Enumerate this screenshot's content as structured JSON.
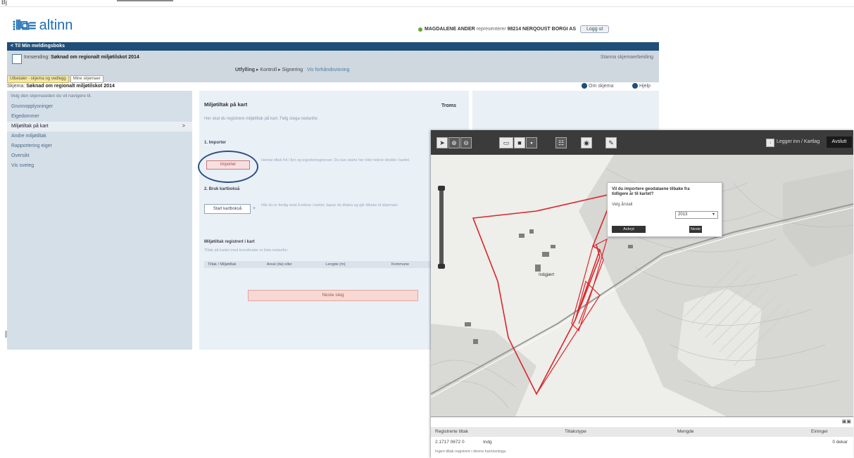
{
  "window": {
    "topstrip_text": "Bj"
  },
  "header": {
    "logo_text": "altinn",
    "user_name": "MAGDALENE ANDER",
    "user_role": "representerer",
    "org_name": "98214 NERQOUST BORGI AS",
    "logout_label": "Logg ut"
  },
  "nav": {
    "back_label": "< Til Min meldingsboks"
  },
  "form": {
    "title_prefix": "Innsending:",
    "title": "Søknad om regionalt miljøtilskot 2014",
    "right_link": "Stanna skjemaerbeiding",
    "steps": {
      "s1": "Utfylling",
      "s2": "Kontroll",
      "s3": "Signering",
      "link": "Vis forhåndsvisning"
    },
    "tabs": [
      "Utbetaler - skjema og vedlegg",
      "Mine skjemaer"
    ],
    "subject_prefix": "Skjema:",
    "subject": "Søknad om regionalt miljøtilskot 2014",
    "help1": "Om skjema",
    "help2": "Hjelp"
  },
  "sidebar": {
    "intro": "Velg den skjemasiden du vil navigere til.",
    "items": [
      "Grunnopplysninger",
      "Eigedommer",
      "Miljøtiltak på kart",
      "Andre miljøtiltak",
      "Rapportering eiger",
      "Oversikt",
      "Vis sveteg"
    ]
  },
  "content": {
    "heading": "Miljøtiltak på kart",
    "county": "Troms",
    "desc": "Her skal du registrere miljøtiltak på kart. Følg stega nedanfor.",
    "step1": "1. Importer",
    "import_label": "Importer",
    "hint1": "Hentar tiltak frå i fjor og eigedomsgrenser. Du kan starte her eller teikne direkte i kartet.",
    "step2": "2. Bruk kartbokså",
    "kart_label": "Start kartbokså",
    "hint2": "Når du er ferdig med å teikne i kartet, lagrar du tiltaka og går tilbake til skjemaet.",
    "step3": "Miljøtiltak registrert i kart",
    "desc3": "Tiltak på kartet med koordinater er lista nedanfor:",
    "table_headers": [
      "Tiltak / Miljøtiltak",
      "Areal (da) eller",
      "Lengde (m)",
      "Kommune"
    ],
    "add_label": "Neste steg"
  },
  "map": {
    "tools": [
      "pointer-icon",
      "zoom-in-icon",
      "zoom-out-icon",
      "layers-icon",
      "square-icon",
      "grid-icon",
      "table-icon",
      "eye-icon",
      "edit-icon"
    ],
    "layers_label": "Legger inn / Kartlag",
    "finish_label": "Avslutt",
    "popup": {
      "question": "Vil du importere geodataene tilbake fra tidligere år til kartet?",
      "label": "Velg årstall",
      "year": "2013",
      "cancel": "Avbryt",
      "next": "Neste"
    },
    "place_label": "Indgjært",
    "bottom": {
      "col1": "Registrerte tiltak",
      "col2": "Tiltakstype",
      "col3": "Mengde",
      "col4": "Eininger",
      "row_id": "2.1717 0672 0",
      "row_name": "Indg",
      "row_value": "0 dekar",
      "foot": "Ingen tiltak registrert i denne kartvisninga"
    }
  },
  "colors": {
    "navbar": "#1f4e78",
    "accent": "#1b6db3",
    "sidebar": "#d4dfe8",
    "content": "#e9f0f6",
    "polygon": "#d9262c"
  }
}
